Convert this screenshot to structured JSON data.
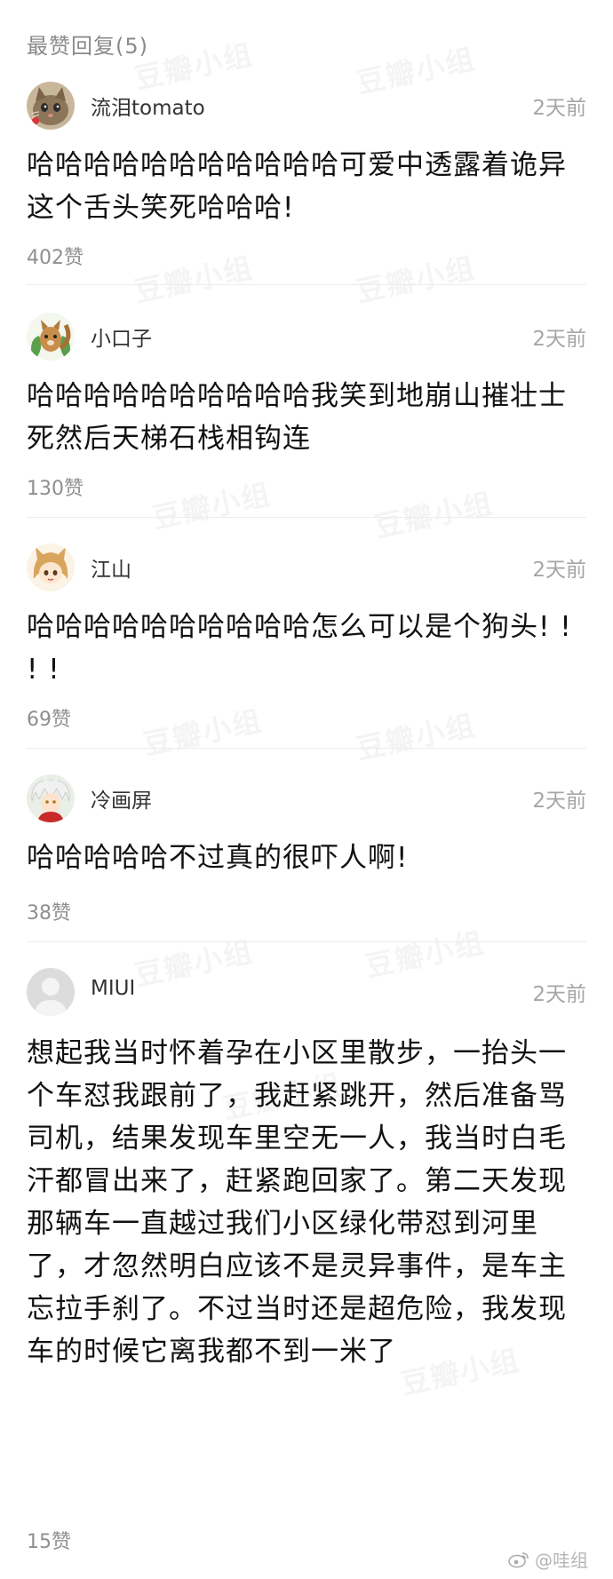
{
  "section": {
    "title": "最赞回复(5)"
  },
  "watermark_text": "豆瓣小组",
  "comments": [
    {
      "username": "流泪tomato",
      "time": "2天前",
      "text": "哈哈哈哈哈哈哈哈哈哈哈可爱中透露着诡异 这个舌头笑死哈哈哈!",
      "likes": "402赞",
      "avatar": "cat-avatar"
    },
    {
      "username": "小口子",
      "time": "2天前",
      "text": "哈哈哈哈哈哈哈哈哈哈我笑到地崩山摧壮士死然后天梯石栈相钩连",
      "likes": "130赞",
      "avatar": "squirrel-avatar"
    },
    {
      "username": "江山",
      "time": "2天前",
      "text": "哈哈哈哈哈哈哈哈哈哈怎么可以是个狗头! ! ! !",
      "likes": "69赞",
      "avatar": "anime-girl-avatar"
    },
    {
      "username": "冷画屏",
      "time": "2天前",
      "text": "哈哈哈哈哈不过真的很吓人啊!",
      "likes": "38赞",
      "avatar": "anime-character-avatar"
    },
    {
      "username": "MIUI",
      "time": "2天前",
      "text": "想起我当时怀着孕在小区里散步，一抬头一个车怼我跟前了，我赶紧跳开，然后准备骂司机，结果发现车里空无一人，我当时白毛汗都冒出来了，赶紧跑回家了。第二天发现那辆车一直越过我们小区绿化带怼到河里了，才忽然明白应该不是灵异事件，是车主忘拉手刹了。不过当时还是超危险，我发现车的时候它离我都不到一米了",
      "likes": "15赞",
      "avatar": "default-user-avatar"
    }
  ],
  "footer": {
    "weibo_handle": "@哇组",
    "icon": "weibo-icon"
  }
}
